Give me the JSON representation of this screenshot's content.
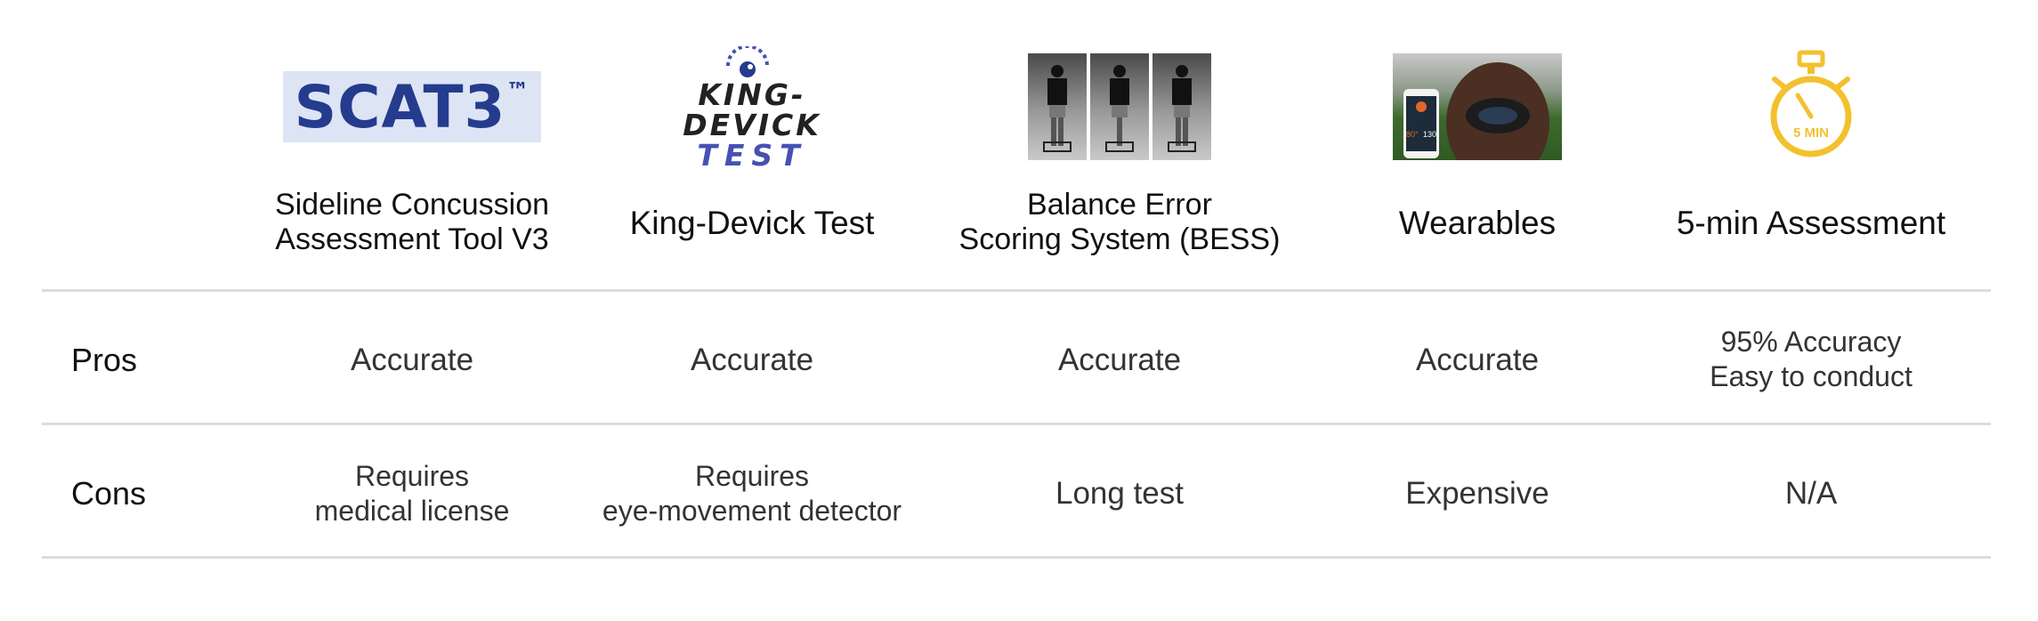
{
  "columns": [
    {
      "id": "scat3",
      "logo": {
        "text": "SCAT3",
        "mark": "™",
        "bg_color": "#dde4f3",
        "text_color": "#253b8e"
      },
      "title": "Sideline Concussion\nAssessment Tool V3",
      "pros": "Accurate",
      "cons": "Requires\nmedical license"
    },
    {
      "id": "king-devick",
      "logo": {
        "line1": "KING-",
        "line2": "DEVICK",
        "line3": "TEST",
        "icon": "eye-icon",
        "accent_color": "#4651b3"
      },
      "title": "King-Devick Test",
      "pros": "Accurate",
      "cons": "Requires\neye-movement detector"
    },
    {
      "id": "bess",
      "logo": {
        "image": "three-stance-photos"
      },
      "title": "Balance Error\nScoring System (BESS)",
      "pros": "Accurate",
      "cons": "Long test"
    },
    {
      "id": "wearables",
      "logo": {
        "image": "phone-and-head-sensor-photo",
        "phone_temp": "80°",
        "phone_value": "130"
      },
      "title": "Wearables",
      "pros": "Accurate",
      "cons": "Expensive"
    },
    {
      "id": "five-min",
      "logo": {
        "icon": "stopwatch-icon",
        "label": "5 MIN",
        "color": "#f3c12e"
      },
      "title": "5-min Assessment",
      "pros": "95% Accuracy\nEasy to conduct",
      "cons": "N/A"
    }
  ],
  "rows": {
    "pros_label": "Pros",
    "cons_label": "Cons"
  },
  "colors": {
    "rule": "#dcdcdc",
    "text": "#111111"
  }
}
